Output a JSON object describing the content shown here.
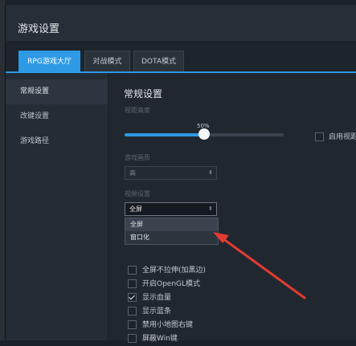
{
  "window": {
    "title": "游戏设置"
  },
  "tabs": [
    {
      "label": "RPG游戏大厅",
      "active": true
    },
    {
      "label": "对战模式",
      "active": false
    },
    {
      "label": "DOTA模式",
      "active": false
    }
  ],
  "sidebar": {
    "items": [
      {
        "label": "常规设置",
        "active": true
      },
      {
        "label": "改键设置",
        "active": false
      },
      {
        "label": "游戏路径",
        "active": false
      }
    ]
  },
  "main": {
    "section_title": "常规设置",
    "view_height": {
      "label": "视距高度",
      "value_text": "50%",
      "value": 0.5
    },
    "borderless_checkbox": {
      "label": "启用视距",
      "checked": false
    },
    "graphics": {
      "label": "游戏画质",
      "selected": "高"
    },
    "display": {
      "label": "视频设置",
      "selected": "全屏",
      "options": [
        "全屏",
        "窗口化"
      ],
      "hovered_option": "窗口化"
    },
    "checkboxes": [
      {
        "label": "全屏不拉伸(加黑边)",
        "checked": false
      },
      {
        "label": "开启OpenGL模式",
        "checked": false
      },
      {
        "label": "显示血量",
        "checked": true
      },
      {
        "label": "显示蓝条",
        "checked": false
      },
      {
        "label": "禁用小地图右键",
        "checked": false
      },
      {
        "label": "屏蔽Win键",
        "checked": false
      }
    ]
  },
  "colors": {
    "accent": "#2e9ae6",
    "annotation_arrow": "#e23b32"
  },
  "icons": {
    "select_arrow": "chevron-updown-icon",
    "annotation": "red-arrow-annotation"
  }
}
